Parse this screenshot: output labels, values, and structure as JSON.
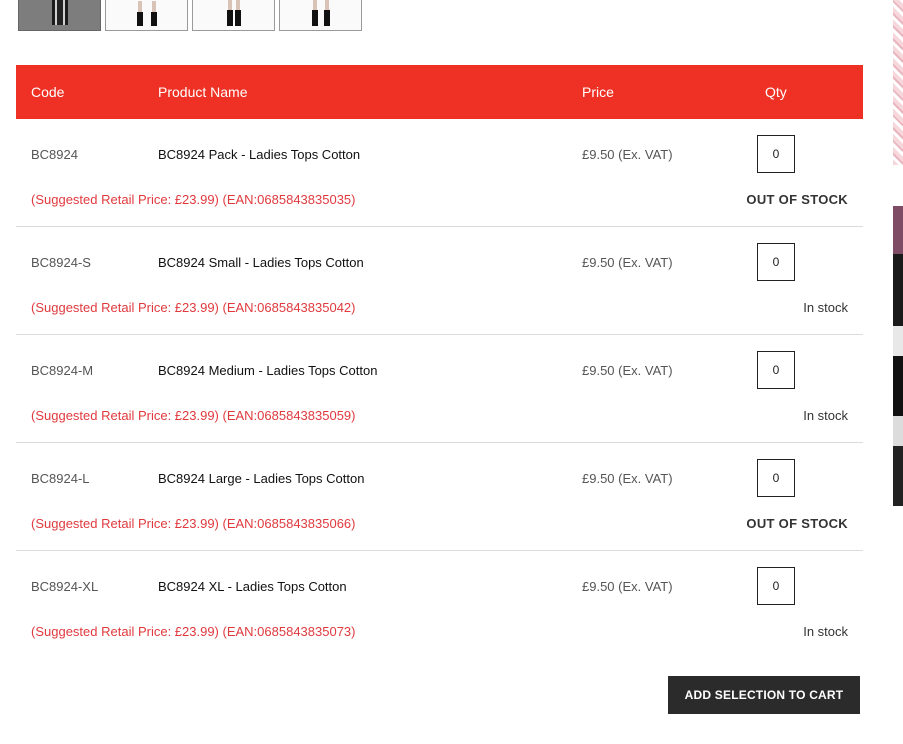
{
  "gallery": {
    "thumbnail_count": 4,
    "active_index": 0
  },
  "table": {
    "headers": {
      "code": "Code",
      "name": "Product Name",
      "price": "Price",
      "qty": "Qty"
    },
    "rows": [
      {
        "code": "BC8924",
        "name": "BC8924 Pack - Ladies Tops Cotton",
        "price": "£9.50 (Ex. VAT)",
        "qty": "0",
        "srp": "(Suggested Retail Price: £23.99) (EAN:0685843835035)",
        "stock": "OUT OF STOCK"
      },
      {
        "code": "BC8924-S",
        "name": "BC8924 Small - Ladies Tops Cotton",
        "price": "£9.50 (Ex. VAT)",
        "qty": "0",
        "srp": "(Suggested Retail Price: £23.99) (EAN:0685843835042)",
        "stock": "In stock"
      },
      {
        "code": "BC8924-M",
        "name": "BC8924 Medium - Ladies Tops Cotton",
        "price": "£9.50 (Ex. VAT)",
        "qty": "0",
        "srp": "(Suggested Retail Price: £23.99) (EAN:0685843835059)",
        "stock": "In stock"
      },
      {
        "code": "BC8924-L",
        "name": "BC8924 Large - Ladies Tops Cotton",
        "price": "£9.50 (Ex. VAT)",
        "qty": "0",
        "srp": "(Suggested Retail Price: £23.99) (EAN:0685843835066)",
        "stock": "OUT OF STOCK"
      },
      {
        "code": "BC8924-XL",
        "name": "BC8924 XL - Ladies Tops Cotton",
        "price": "£9.50 (Ex. VAT)",
        "qty": "0",
        "srp": "(Suggested Retail Price: £23.99) (EAN:0685843835073)",
        "stock": "In stock"
      }
    ]
  },
  "actions": {
    "add_to_cart_label": "ADD SELECTION TO CART"
  },
  "colors": {
    "header_bg": "#ee3124",
    "srp_text": "#e03a3e",
    "button_bg": "#2b2b2b"
  }
}
